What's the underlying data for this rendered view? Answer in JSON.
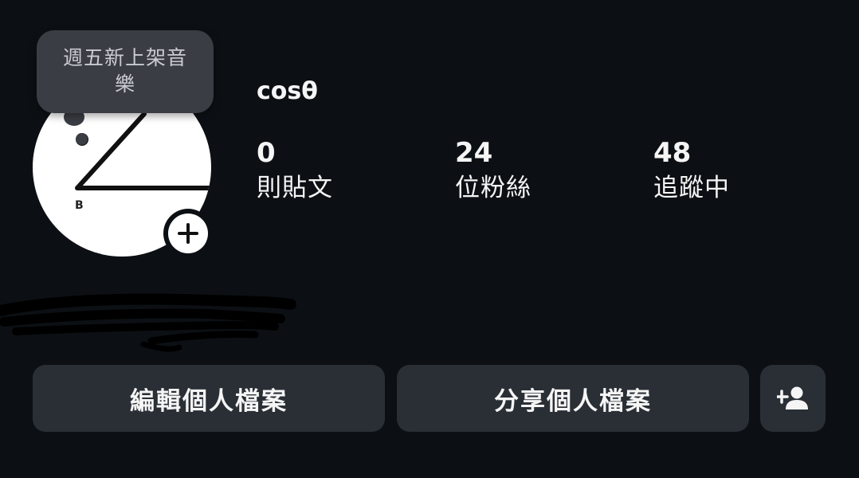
{
  "note": {
    "text": "週五新上架音樂"
  },
  "profile": {
    "username": "cosθ",
    "avatar_letter": "B"
  },
  "stats": [
    {
      "value": "0",
      "label": "則貼文"
    },
    {
      "value": "24",
      "label": "位粉絲"
    },
    {
      "value": "48",
      "label": "追蹤中"
    }
  ],
  "buttons": {
    "edit_label": "編輯個人檔案",
    "share_label": "分享個人檔案"
  },
  "icons": {
    "avatar_add": "plus-icon",
    "add_user": "person-add-icon"
  },
  "colors": {
    "background": "#0c1014",
    "button_bg": "#2a2f36",
    "note_bg": "#3a3d44",
    "text": "#f5f5f5"
  }
}
